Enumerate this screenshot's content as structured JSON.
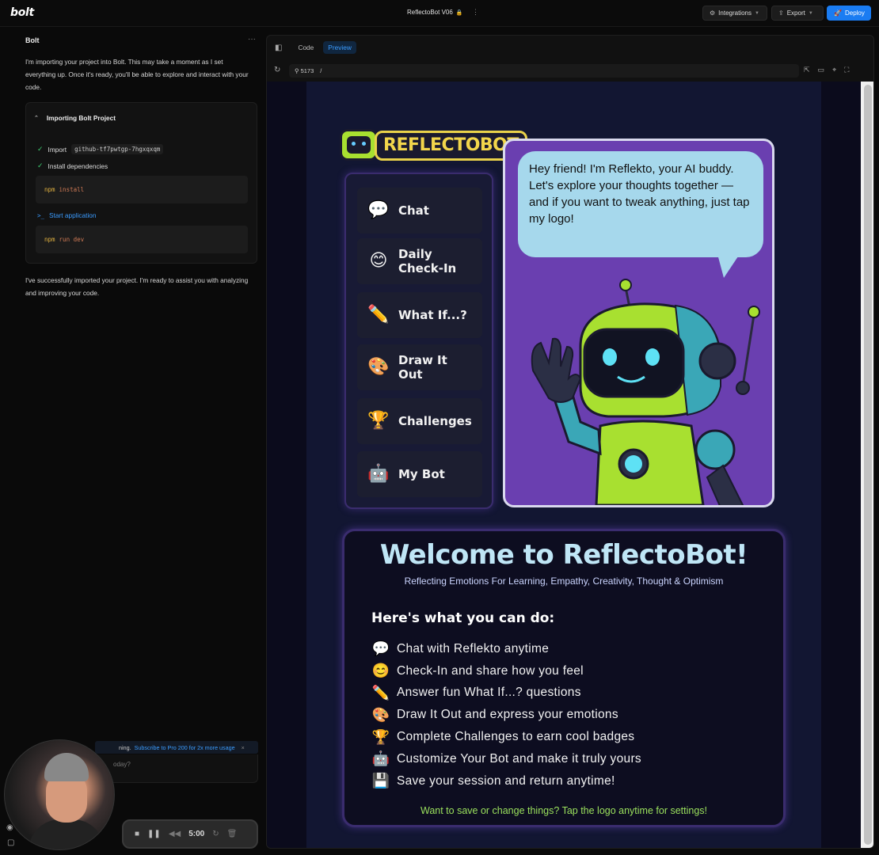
{
  "topbar": {
    "logo": "bolt",
    "project_name": "ReflectoBot V06",
    "integrations_label": "Integrations",
    "export_label": "Export",
    "deploy_label": "Deploy"
  },
  "chat": {
    "title": "Bolt",
    "intro_message": "I'm importing your project into Bolt. This may take a moment as I set everything up. Once it's ready, you'll be able to explore and interact with your code.",
    "card_title": "Importing Bolt Project",
    "steps": [
      {
        "label": "Import",
        "code": "github-tf7pwtgp-7hgxqxqm"
      },
      {
        "label": "Install dependencies"
      },
      {
        "label": "Start application"
      }
    ],
    "commands": [
      {
        "keyword": "npm",
        "arg": "install"
      },
      {
        "keyword": "npm",
        "arg": "run dev"
      }
    ],
    "done_message": "I've successfully imported your project. I'm ready to assist you with analyzing and improving your code.",
    "notice_text": "ning.",
    "notice_link": "Subscribe to Pro 200 for 2x more usage",
    "prompt_placeholder": "oday?",
    "recorder_time": "5:00"
  },
  "workbench": {
    "tab_code": "Code",
    "tab_preview": "Preview",
    "port": "5173",
    "path": "/"
  },
  "app": {
    "logo_text": "REFLECTOBOT",
    "menu": [
      {
        "icon": "💬",
        "label": "Chat"
      },
      {
        "icon": "😊",
        "label": "Daily Check-In"
      },
      {
        "icon": "✏️",
        "label": "What If...?"
      },
      {
        "icon": "🎨",
        "label": "Draw It Out"
      },
      {
        "icon": "🏆",
        "label": "Challenges"
      },
      {
        "icon": "🤖",
        "label": "My Bot"
      }
    ],
    "bubble_text": "Hey friend! I'm Reflekto, your AI buddy. Let's explore your thoughts together — and if you want to tweak anything, just tap my logo!",
    "welcome_title": "Welcome to ReflectoBot!",
    "welcome_subtitle": "Reflecting Emotions For Learning, Empathy, Creativity, Thought & Optimism",
    "features_heading": "Here's what you can do:",
    "features": [
      {
        "icon": "💬",
        "text": "Chat with Reflekto anytime"
      },
      {
        "icon": "😊",
        "text": "Check-In and share how you feel"
      },
      {
        "icon": "✏️",
        "text": "Answer fun What If...? questions"
      },
      {
        "icon": "🎨",
        "text": "Draw It Out and express your emotions"
      },
      {
        "icon": "🏆",
        "text": "Complete Challenges to earn cool badges"
      },
      {
        "icon": "🤖",
        "text": "Customize Your Bot and make it truly yours"
      },
      {
        "icon": "💾",
        "text": "Save your session and return anytime!"
      }
    ],
    "footer_text": "Want to save or change things? Tap the logo anytime for settings!"
  },
  "colors": {
    "accent_blue": "#1a7cf2",
    "panel_purple": "#6a3fb0",
    "bubble_blue": "#a6d8ec",
    "logo_yellow": "#f2d64b",
    "robot_green": "#a8e030",
    "footer_green": "#9be15d"
  }
}
